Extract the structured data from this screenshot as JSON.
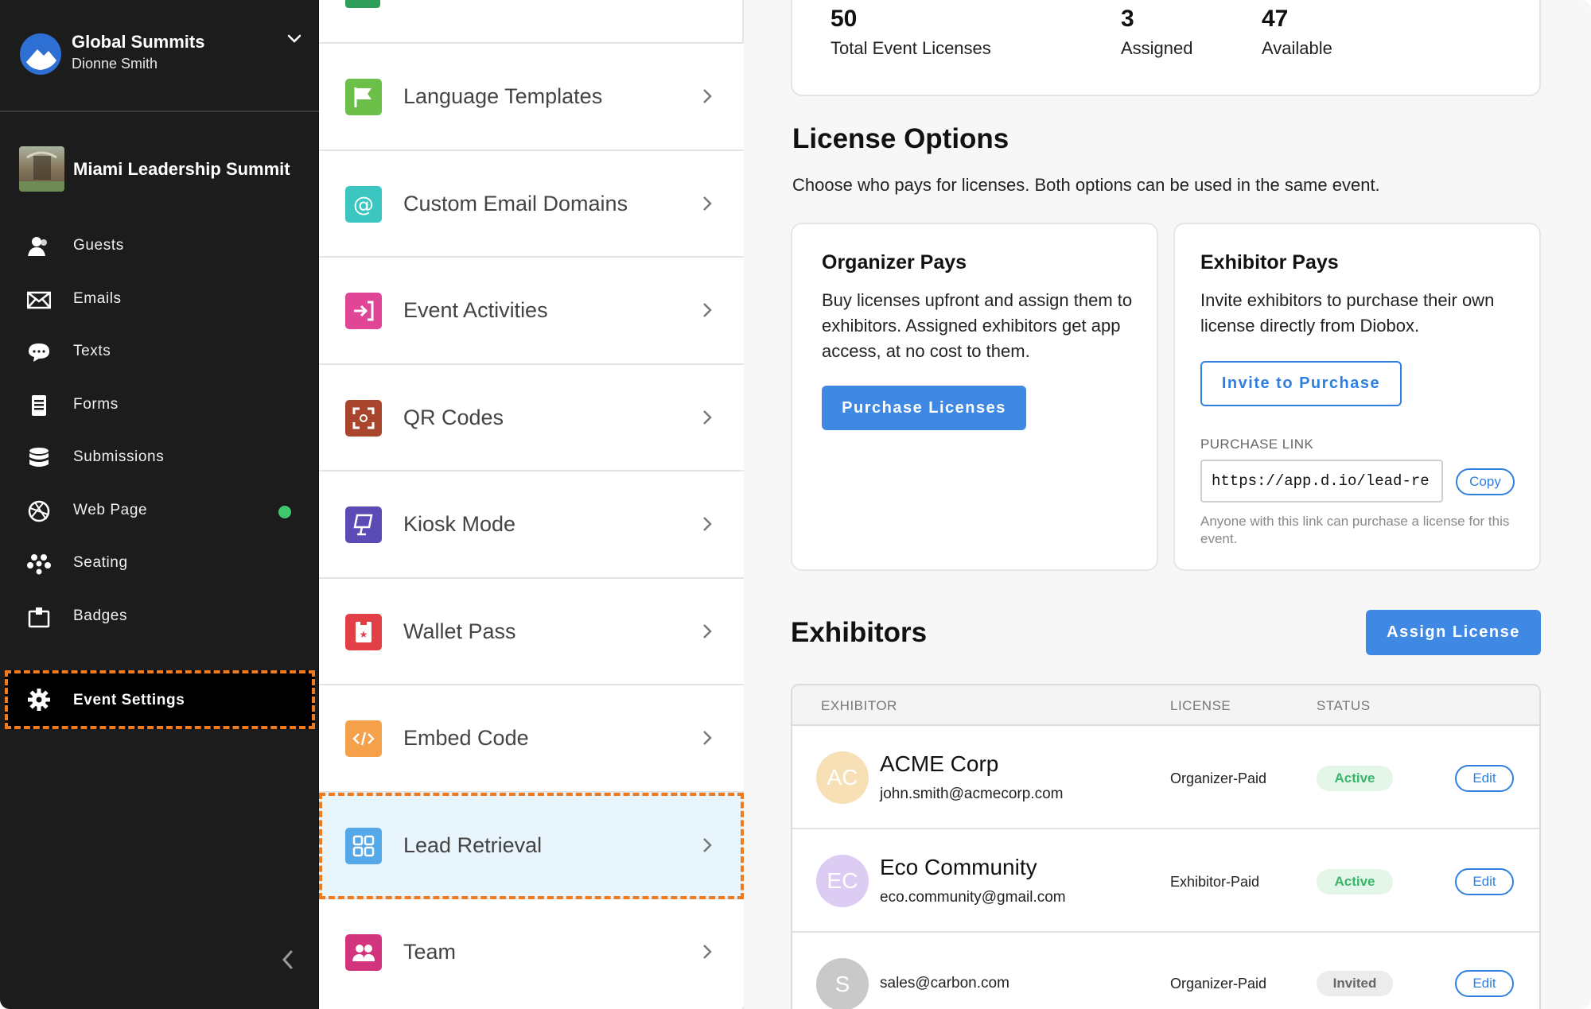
{
  "org": {
    "name": "Global Summits",
    "user": "Dionne Smith"
  },
  "event": {
    "name": "Miami Leadership Summit"
  },
  "nav": {
    "items": [
      {
        "label": "Guests",
        "icon": "guests-icon"
      },
      {
        "label": "Emails",
        "icon": "envelope-icon"
      },
      {
        "label": "Texts",
        "icon": "chat-bubble-icon"
      },
      {
        "label": "Forms",
        "icon": "form-icon"
      },
      {
        "label": "Submissions",
        "icon": "database-icon"
      },
      {
        "label": "Web Page",
        "icon": "globe-icon"
      },
      {
        "label": "Seating",
        "icon": "seating-icon"
      },
      {
        "label": "Badges",
        "icon": "badge-icon"
      }
    ],
    "settings_label": "Event Settings"
  },
  "menu": {
    "items": [
      {
        "label": "Language Templates",
        "icon": "flag-icon",
        "color": "#6cc04a"
      },
      {
        "label": "Custom Email Domains",
        "icon": "at-sign-icon",
        "color": "#3cc6c1"
      },
      {
        "label": "Event Activities",
        "icon": "check-in-icon",
        "color": "#e04596"
      },
      {
        "label": "QR Codes",
        "icon": "qr-scan-icon",
        "color": "#a9452c"
      },
      {
        "label": "Kiosk Mode",
        "icon": "kiosk-icon",
        "color": "#5a4bb5"
      },
      {
        "label": "Wallet Pass",
        "icon": "ticket-icon",
        "color": "#e23f46"
      },
      {
        "label": "Embed Code",
        "icon": "code-icon",
        "color": "#f5a04a"
      },
      {
        "label": "Lead Retrieval",
        "icon": "grid-icon",
        "color": "#55a9e8"
      },
      {
        "label": "Team",
        "icon": "team-icon",
        "color": "#d2357e"
      }
    ]
  },
  "stats": {
    "total": {
      "value": "50",
      "label": "Total Event Licenses"
    },
    "assigned": {
      "value": "3",
      "label": "Assigned"
    },
    "available": {
      "value": "47",
      "label": "Available"
    }
  },
  "license_options": {
    "title": "License Options",
    "subtitle": "Choose who pays for licenses. Both options can be used in the same event.",
    "organizer": {
      "title": "Organizer Pays",
      "body": "Buy licenses upfront and assign them to exhibitors. Assigned exhibitors get app access, at no cost to them.",
      "button": "Purchase Licenses"
    },
    "exhibitor": {
      "title": "Exhibitor Pays",
      "body": "Invite exhibitors to purchase their own license directly from Diobox.",
      "button": "Invite to Purchase",
      "link_label": "PURCHASE LINK",
      "link_value": "https://app.d.io/lead-re",
      "copy_label": "Copy",
      "note": "Anyone with this link can purchase a license for this event."
    }
  },
  "exhibitors": {
    "title": "Exhibitors",
    "assign_button": "Assign License",
    "columns": [
      "EXHIBITOR",
      "LICENSE",
      "STATUS"
    ],
    "rows": [
      {
        "initials": "AC",
        "avatar_color": "#f7dfb6",
        "name": "ACME Corp",
        "email": "john.smith@acmecorp.com",
        "license": "Organizer-Paid",
        "status": "Active",
        "edit": "Edit"
      },
      {
        "initials": "EC",
        "avatar_color": "#dccbf3",
        "name": "Eco Community",
        "email": "eco.community@gmail.com",
        "license": "Exhibitor-Paid",
        "status": "Active",
        "edit": "Edit"
      },
      {
        "initials": "S",
        "avatar_color": "#c9c9c9",
        "name": "",
        "email": "sales@carbon.com",
        "license": "Organizer-Paid",
        "status": "Invited",
        "edit": "Edit"
      }
    ]
  }
}
